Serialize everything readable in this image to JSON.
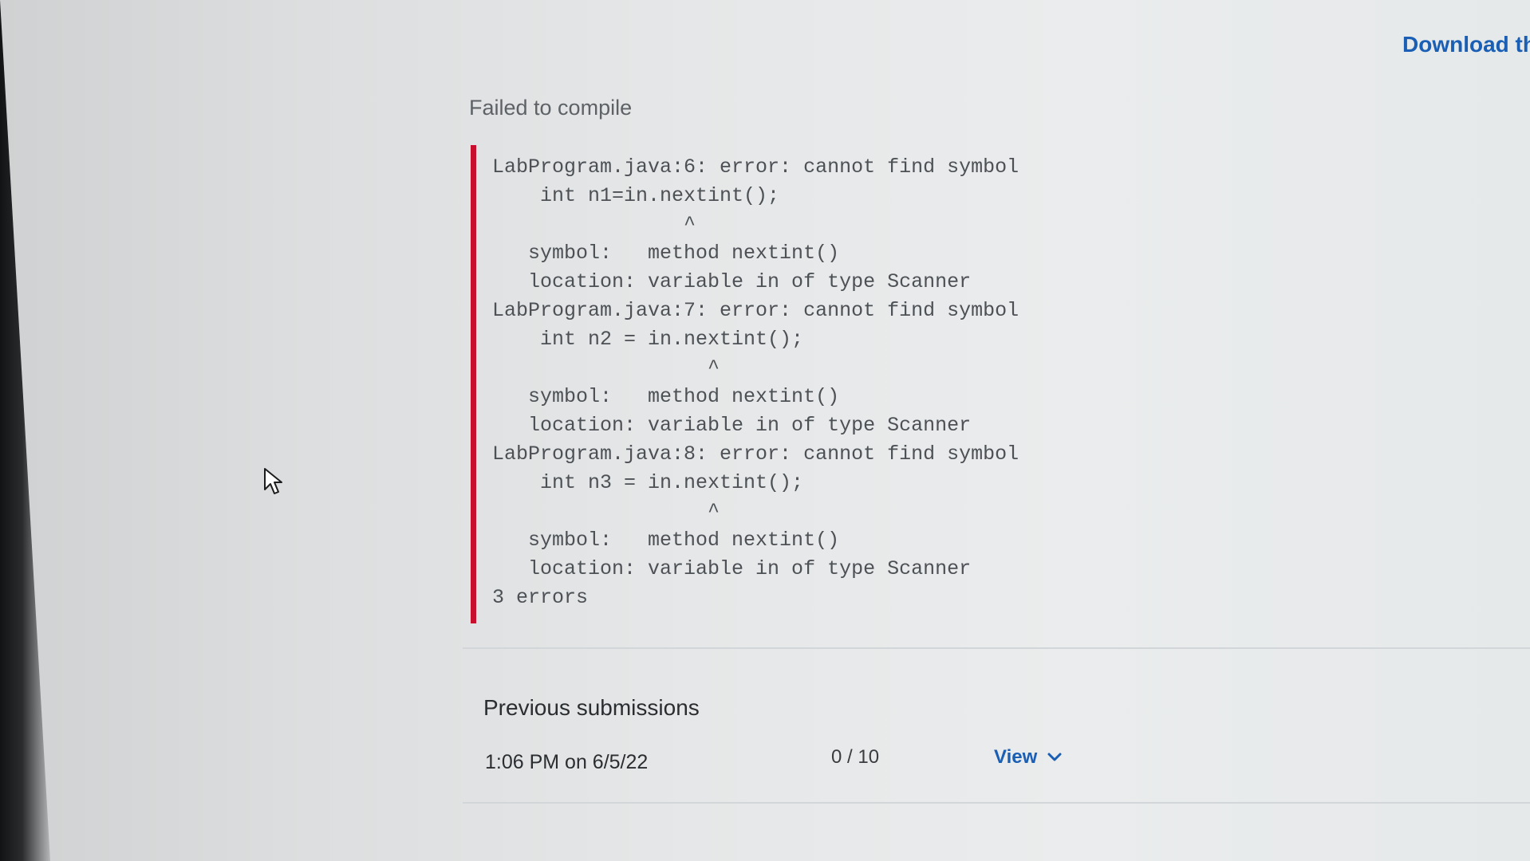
{
  "header": {
    "download_label": "Download th"
  },
  "result": {
    "title": "Failed to compile",
    "error_lines": [
      "LabProgram.java:6: error: cannot find symbol",
      "    int n1=in.nextint();",
      "                ^",
      "   symbol:   method nextint()",
      "   location: variable in of type Scanner",
      "LabProgram.java:7: error: cannot find symbol",
      "    int n2 = in.nextint();",
      "                  ^",
      "   symbol:   method nextint()",
      "   location: variable in of type Scanner",
      "LabProgram.java:8: error: cannot find symbol",
      "    int n3 = in.nextint();",
      "                  ^",
      "   symbol:   method nextint()",
      "   location: variable in of type Scanner",
      "3 errors"
    ],
    "error_bar_color": "#c8102e"
  },
  "previous_submissions": {
    "title": "Previous submissions",
    "rows": [
      {
        "date": "1:06 PM on 6/5/22",
        "score": "0 / 10",
        "view_label": "View"
      }
    ]
  },
  "icons": {
    "view_expand": "chevron-down-icon",
    "pointer": "mouse-cursor-icon"
  },
  "colors": {
    "link": "#1a5fb4",
    "error": "#c8102e"
  }
}
